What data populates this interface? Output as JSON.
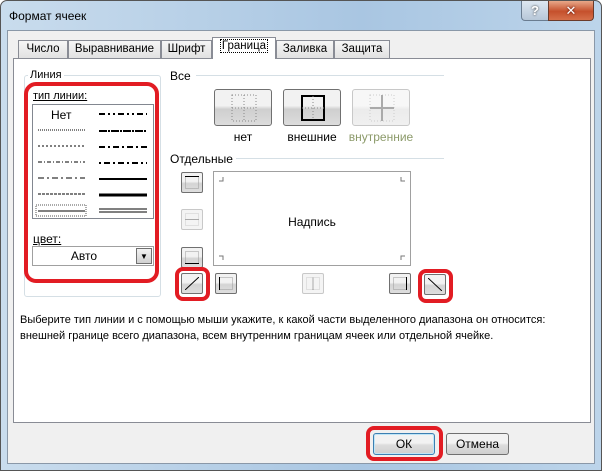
{
  "window": {
    "title": "Формат ячеек",
    "help_label": "?",
    "close_label": "✕"
  },
  "tabs": [
    {
      "label": "Число"
    },
    {
      "label": "Выравнивание"
    },
    {
      "label": "Шрифт"
    },
    {
      "label": "Граница",
      "selected": true
    },
    {
      "label": "Заливка"
    },
    {
      "label": "Защита"
    }
  ],
  "line_group": {
    "title": "Линия",
    "style_label": "тип линии:",
    "none_label": "Нет",
    "color_label": "цвет:",
    "color_value": "Авто"
  },
  "presets": {
    "title": "Все",
    "buttons": [
      {
        "label": "нет"
      },
      {
        "label": "внешние"
      },
      {
        "label": "внутренние",
        "disabled": true
      }
    ]
  },
  "border": {
    "title": "Отдельные",
    "preview_text": "Надпись"
  },
  "description": [
    "Выберите тип линии и с помощью мыши укажите, к какой части выделенного диапазона он относится:",
    "внешней границе всего диапазона, всем внутренним границам ячеек или отдельной ячейке."
  ],
  "footer": {
    "ok_label": "ОК",
    "cancel_label": "Отмена"
  },
  "colors": {
    "highlight": "#e21c23",
    "accent": "#3c7fb1"
  }
}
